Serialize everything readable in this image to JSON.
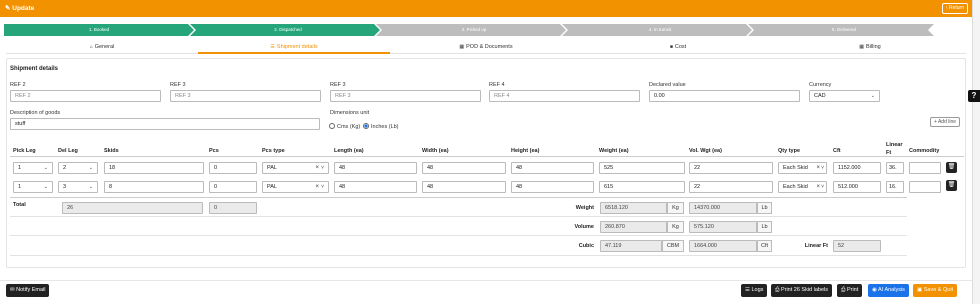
{
  "header": {
    "title": "Update",
    "return_label": "Return",
    "pencil_icon": "pencil-icon",
    "chevron_icon": "chevron-left-icon",
    "color": "#f39200"
  },
  "steps": [
    {
      "label": "1. Booked",
      "state": "done"
    },
    {
      "label": "2. Dispatched",
      "state": "done"
    },
    {
      "label": "3. Picked up",
      "state": "pending"
    },
    {
      "label": "4. In transit",
      "state": "pending"
    },
    {
      "label": "5. Delivered",
      "state": "pending"
    }
  ],
  "step_colors": {
    "done": "#27a57a",
    "pending": "#bdbdbd"
  },
  "tabs": [
    {
      "label": "General",
      "icon": "home-icon",
      "active": false
    },
    {
      "label": "Shipment details",
      "icon": "list-icon",
      "active": true
    },
    {
      "label": "POD & Documents",
      "icon": "grid-icon",
      "active": false
    },
    {
      "label": "Cost",
      "icon": "square-icon",
      "active": false
    },
    {
      "label": "Billing",
      "icon": "grid-icon",
      "active": false
    }
  ],
  "section_title": "Shipment details",
  "refs": [
    {
      "label": "REF 2",
      "placeholder": "REF 2"
    },
    {
      "label": "REF 3",
      "placeholder": "REF 3"
    },
    {
      "label": "REF 3",
      "placeholder": "REF 3"
    },
    {
      "label": "REF 4",
      "placeholder": "REF 4"
    }
  ],
  "declared": {
    "label": "Declared value",
    "value": "0.00"
  },
  "currency": {
    "label": "Currency",
    "value": "CAD"
  },
  "description": {
    "label": "Description of goods",
    "value": "stuff"
  },
  "dimensions": {
    "label": "Dimensions unit",
    "options": [
      "Cms (Kg)",
      "Inches (Lb)"
    ],
    "selected": "Inches (Lb)"
  },
  "add_line": "+ Add line",
  "columns": [
    "Pick Leg",
    "Del Leg",
    "Skids",
    "Pcs",
    "Pcs type",
    "Length (ea)",
    "Width (ea)",
    "Height (ea)",
    "Weight (ea)",
    "Vol. Wgt (ea)",
    "Qty type",
    "Cft",
    "Linear Ft",
    "Commodity"
  ],
  "rows": [
    {
      "pick_leg": "1",
      "del_leg": "2",
      "skids": "18",
      "pcs": "0",
      "pcs_type": "PAL",
      "length": "48",
      "width": "48",
      "height": "48",
      "weight": "525",
      "vol_wgt": "22",
      "qty_type": "Each Skid",
      "cft": "1152.000",
      "linear_ft": "36.",
      "commodity": ""
    },
    {
      "pick_leg": "1",
      "del_leg": "3",
      "skids": "8",
      "pcs": "0",
      "pcs_type": "PAL",
      "length": "48",
      "width": "48",
      "height": "48",
      "weight": "615",
      "vol_wgt": "22",
      "qty_type": "Each Skid",
      "cft": "512.000",
      "linear_ft": "16.",
      "commodity": ""
    }
  ],
  "totals": {
    "label": "Total",
    "skids": "26",
    "pcs": "0",
    "weight": {
      "label": "Weight",
      "value": "6518.120",
      "unit": "Kg",
      "alt_value": "14370.000",
      "alt_unit": "Lb"
    },
    "volume": {
      "label": "Volume",
      "value": "260.870",
      "unit": "Kg",
      "alt_value": "575.120",
      "alt_unit": "Lb"
    },
    "cubic": {
      "label": "Cubic",
      "value": "47.119",
      "unit": "CBM",
      "alt_value": "1664.000",
      "alt_unit": "Cft"
    },
    "linear": {
      "label": "Linear Ft",
      "value": "52"
    }
  },
  "footer": {
    "notify": "Notify Email",
    "logs": "Logs",
    "print_labels": "Print 26 Skid labels",
    "print": "Print",
    "ai": "AI Analysis",
    "save": "Save & Quit"
  }
}
